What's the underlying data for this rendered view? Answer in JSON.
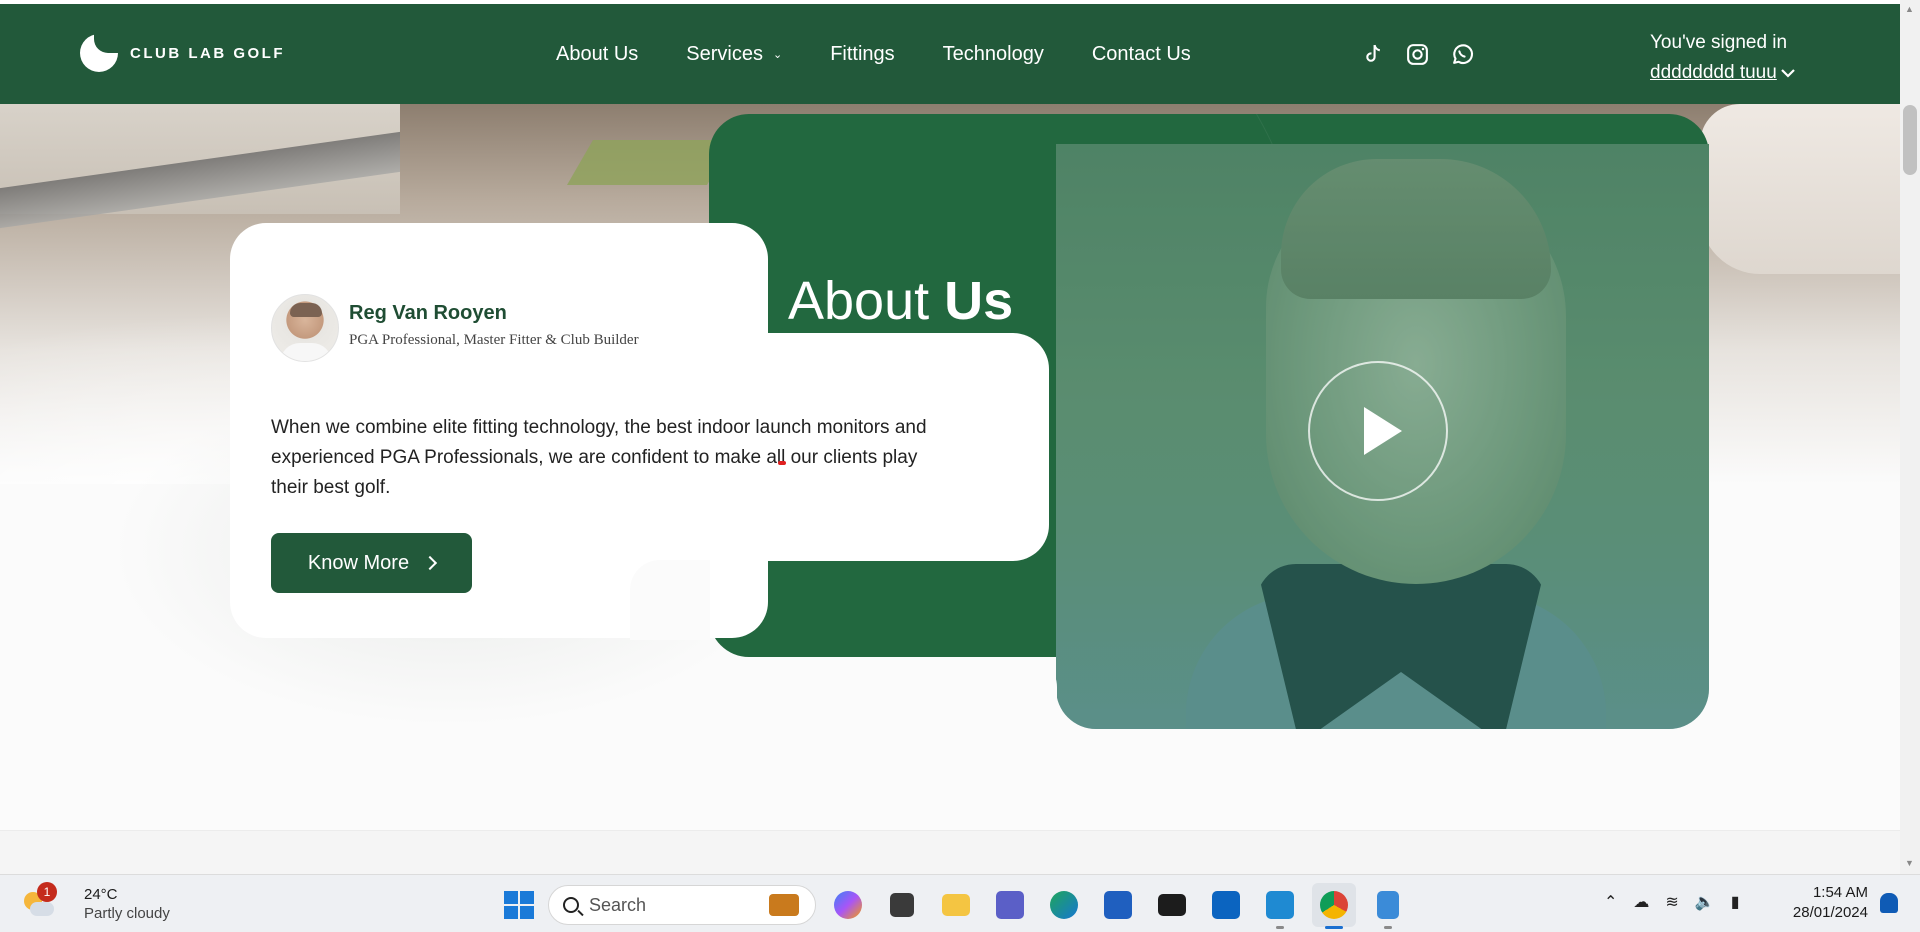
{
  "nav": {
    "logo_text": "CLUB LAB GOLF",
    "links": [
      {
        "label": "About Us"
      },
      {
        "label": "Services",
        "has_dropdown": true
      },
      {
        "label": "Fittings"
      },
      {
        "label": "Technology"
      },
      {
        "label": "Contact Us"
      }
    ],
    "social_icons": [
      "tiktok-icon",
      "instagram-icon",
      "whatsapp-icon"
    ],
    "signed_in_label": "You've signed in",
    "user_name": "dddddddd tuuu"
  },
  "about": {
    "title_light": "About",
    "title_bold": "Us",
    "person_name": "Reg Van Rooyen",
    "person_role": "PGA Professional, Master Fitter & Club Builder",
    "quote": "When we combine elite fitting technology, the best indoor launch monitors and experienced PGA Professionals, we are confident to make all our clients play their best golf.",
    "button_label": "Know More",
    "video_icon": "play-icon"
  },
  "colors": {
    "nav_green": "#22593a",
    "panel_green": "#22683f",
    "button_green": "#22593a"
  },
  "taskbar": {
    "weather_temp": "24°C",
    "weather_condition": "Partly cloudy",
    "weather_badge": "1",
    "search_placeholder": "Search",
    "apps": [
      "copilot-icon",
      "terminal-app-icon",
      "file-explorer-icon",
      "teams-icon",
      "edge-icon",
      "store-icon",
      "console-icon",
      "outlook-icon",
      "vscode-icon",
      "chrome-icon",
      "notepad-icon"
    ],
    "time": "1:54 AM",
    "date": "28/01/2024"
  }
}
